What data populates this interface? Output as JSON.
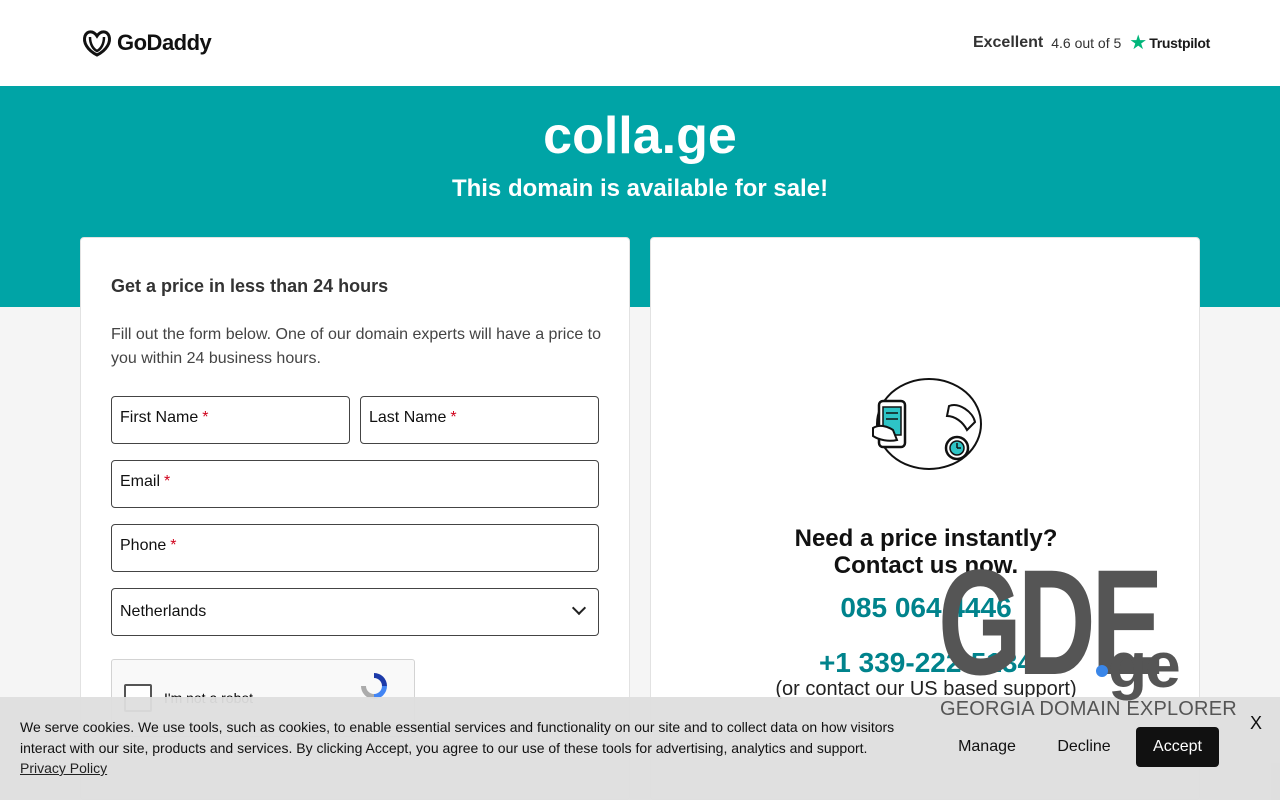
{
  "header": {
    "brand": "GoDaddy",
    "trustpilot": {
      "rating_word": "Excellent",
      "score": "4.6 out of 5",
      "brand": "Trustpilot"
    }
  },
  "hero": {
    "domain": "colla.ge",
    "subtitle": "This domain is available for sale!"
  },
  "form": {
    "title": "Get a price in less than 24 hours",
    "description": "Fill out the form below. One of our domain experts will have a price to you within 24 business hours.",
    "first_name": "First Name",
    "last_name": "Last Name",
    "email": "Email",
    "phone": "Phone",
    "required_mark": "*",
    "country": "Netherlands",
    "captcha_label": "I'm not a robot"
  },
  "contact": {
    "heading_line1": "Need a price instantly?",
    "heading_line2": "Contact us now.",
    "phone_local": "085 064 4446",
    "phone_us": "+1 339-222-5134",
    "support_note": "(or contact our US based support)"
  },
  "cookie_banner": {
    "text": "We serve cookies. We use tools, such as cookies, to enable essential services and functionality on our site and to collect data on how visitors interact with our site, products and services. By clicking Accept, you agree to our use of these tools for advertising, analytics and support.",
    "privacy_link": "Privacy Policy",
    "manage": "Manage",
    "decline": "Decline",
    "accept": "Accept",
    "close": "X"
  },
  "watermark": {
    "word": "GDE",
    "tld": "ge",
    "caption": "GEORGIA DOMAIN EXPLORER"
  },
  "colors": {
    "banner": "#00a4a6",
    "phone_link": "#00838c",
    "trustpilot_star": "#00b67a",
    "required": "#d0021b"
  },
  "icons": [
    "godaddy-logo-icon",
    "trustpilot-star-icon",
    "chevron-down-icon",
    "recaptcha-icon",
    "phone-timer-illustration"
  ]
}
